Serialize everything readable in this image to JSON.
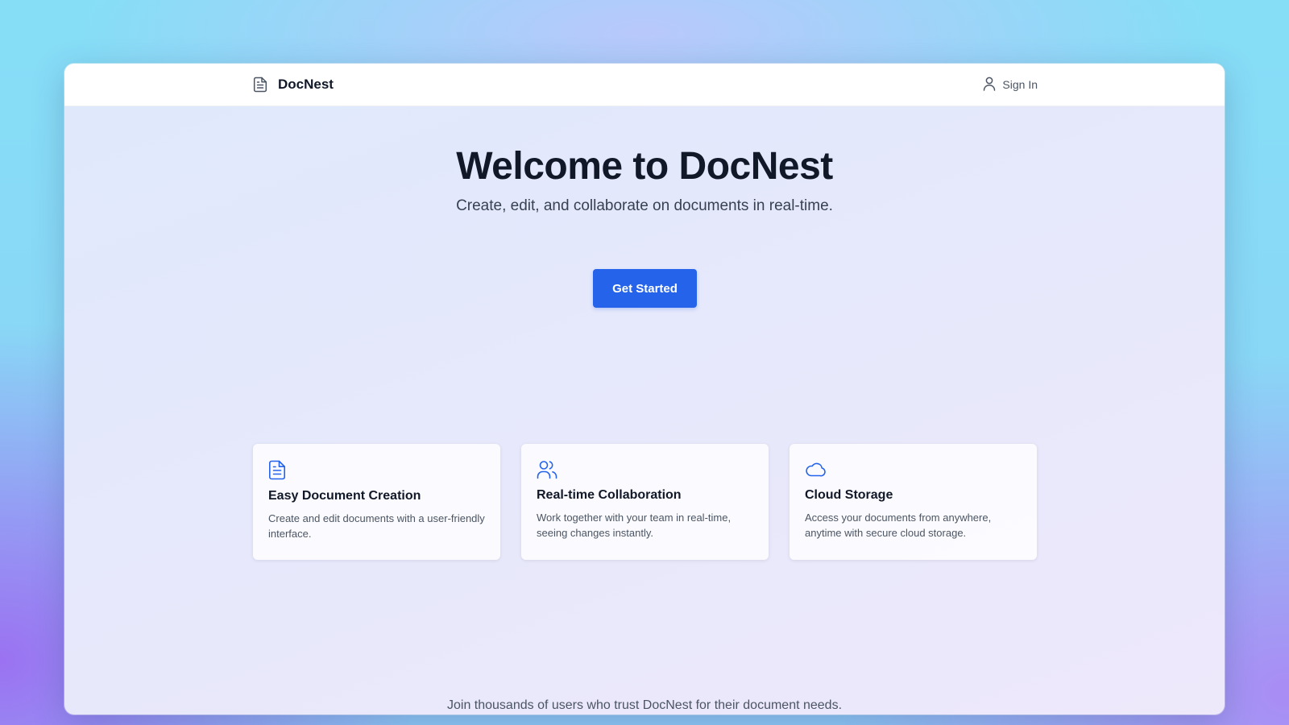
{
  "navbar": {
    "brand_name": "DocNest",
    "brand_icon": "document-icon",
    "signin_label": "Sign In",
    "signin_icon": "user-icon"
  },
  "hero": {
    "title": "Welcome to DocNest",
    "subtitle": "Create, edit, and collaborate on documents in real-time.",
    "cta_label": "Get Started"
  },
  "features": [
    {
      "icon": "document-icon",
      "title": "Easy Document Creation",
      "description": "Create and edit documents with a user-friendly interface."
    },
    {
      "icon": "users-icon",
      "title": "Real-time Collaboration",
      "description": "Work together with your team in real-time, seeing changes instantly."
    },
    {
      "icon": "cloud-icon",
      "title": "Cloud Storage",
      "description": "Access your documents from anywhere, anytime with secure cloud storage."
    }
  ],
  "footer": {
    "tagline": "Join thousands of users who trust DocNest for their document needs."
  },
  "colors": {
    "accent": "#2563eb",
    "heading": "#111827",
    "body_text": "#4b5563"
  }
}
